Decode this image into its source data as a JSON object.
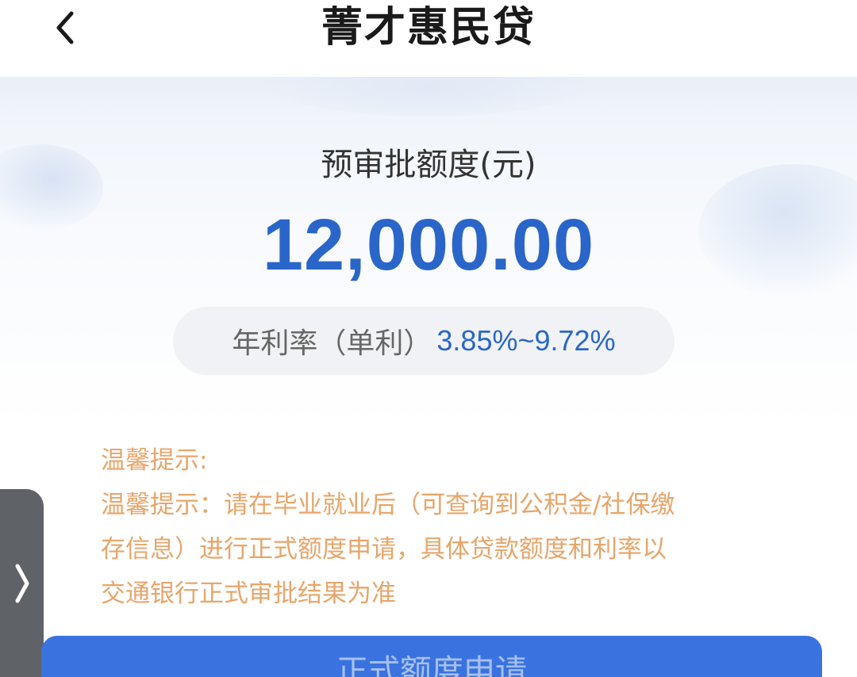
{
  "header": {
    "title": "菁才惠民贷",
    "back_icon": "chevron-left-icon"
  },
  "hero": {
    "limit_label": "预审批额度(元)",
    "limit_amount": "12,000.00",
    "rate_label": "年利率（单利）",
    "rate_value": "3.85%~9.72%"
  },
  "notice": {
    "heading": "温馨提示:",
    "body_lines": [
      "温馨提示：请在毕业就业后（可查询到公积金/社保缴",
      "存信息）进行正式额度申请，具体贷款额度和利率以",
      "交通银行正式审批结果为准"
    ]
  },
  "side_tab": {
    "icon": "chevron-right-icon"
  },
  "footer": {
    "apply_label": "正式额度申请"
  },
  "colors": {
    "accent": "#2a66c9",
    "button": "#3a73df",
    "notice": "#e8a56a",
    "title": "#1a1a1a"
  }
}
